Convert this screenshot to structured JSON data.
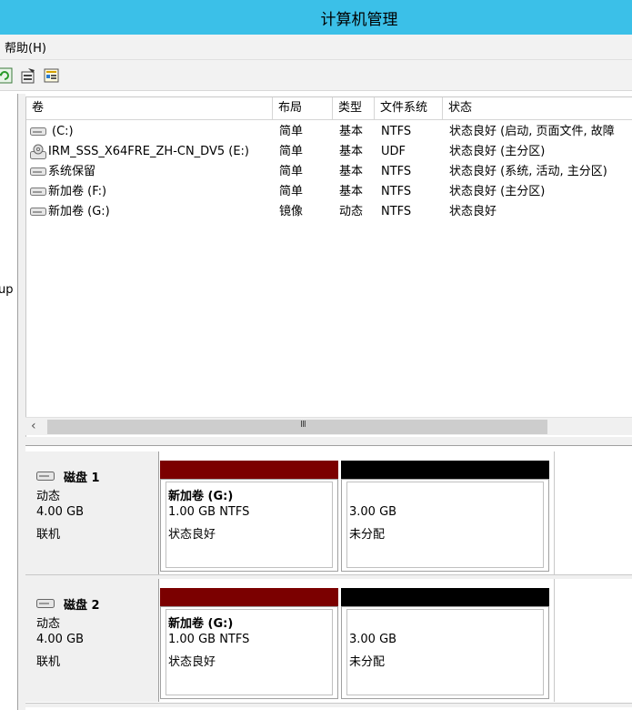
{
  "window": {
    "title": "计算机管理"
  },
  "menu": {
    "items": [
      {
        "label": "帮助(H)"
      }
    ]
  },
  "toolbar": {
    "buttons": [
      {
        "icon": "refresh-icon"
      },
      {
        "icon": "properties-icon"
      },
      {
        "icon": "help-icon"
      }
    ]
  },
  "left_pane": {
    "fragment": "up"
  },
  "volume_table": {
    "columns": [
      "卷",
      "布局",
      "类型",
      "文件系统",
      "状态"
    ],
    "rows": [
      {
        "volume": "(C:)",
        "layout": "简单",
        "type": "基本",
        "fs": "NTFS",
        "status": "状态良好 (启动, 页面文件, 故障"
      },
      {
        "volume": "IRM_SSS_X64FRE_ZH-CN_DV5 (E:)",
        "layout": "简单",
        "type": "基本",
        "fs": "UDF",
        "status": "状态良好 (主分区)"
      },
      {
        "volume": "系统保留",
        "layout": "简单",
        "type": "基本",
        "fs": "NTFS",
        "status": "状态良好 (系统, 活动, 主分区)"
      },
      {
        "volume": "新加卷 (F:)",
        "layout": "简单",
        "type": "基本",
        "fs": "NTFS",
        "status": "状态良好 (主分区)"
      },
      {
        "volume": "新加卷 (G:)",
        "layout": "镜像",
        "type": "动态",
        "fs": "NTFS",
        "status": "状态良好"
      }
    ],
    "scrollbar_grip": "III"
  },
  "colors": {
    "mirrored": "#7b0000",
    "unallocated": "#000000",
    "titlebar": "#3bc0e8"
  },
  "disks": [
    {
      "name": "磁盘 1",
      "kind": "动态",
      "size": "4.00 GB",
      "status": "联机",
      "partition": {
        "name": "新加卷  (G:)",
        "detail": "1.00 GB NTFS",
        "status": "状态良好"
      },
      "unallocated": {
        "size": "3.00 GB",
        "label": "未分配"
      }
    },
    {
      "name": "磁盘 2",
      "kind": "动态",
      "size": "4.00 GB",
      "status": "联机",
      "partition": {
        "name": "新加卷  (G:)",
        "detail": "1.00 GB NTFS",
        "status": "状态良好"
      },
      "unallocated": {
        "size": "3.00 GB",
        "label": "未分配"
      }
    }
  ]
}
